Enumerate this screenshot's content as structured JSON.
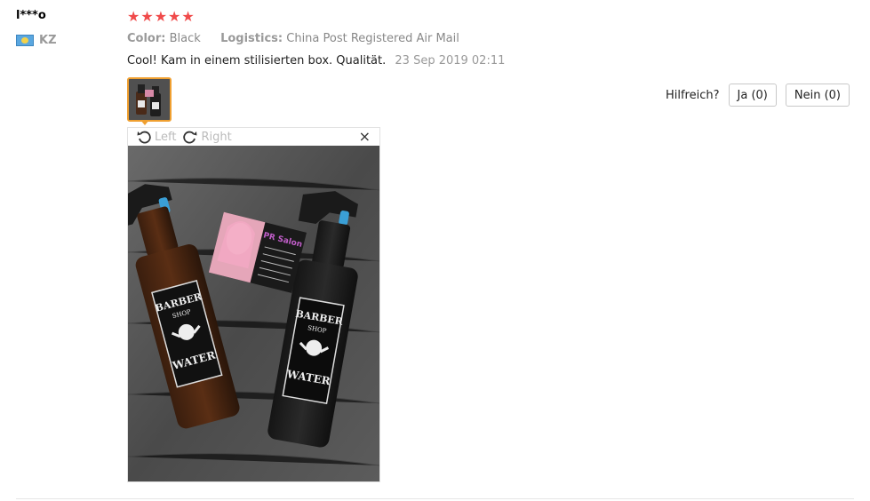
{
  "review": {
    "user_name": "l***o",
    "country_code": "KZ",
    "rating": 5,
    "color_label": "Color:",
    "color_value": "Black",
    "logistics_label": "Logistics:",
    "logistics_value": "China Post Registered Air Mail",
    "text": "Cool! Kam in einem stilisierten box. Qualität.",
    "date": "23 Sep 2019 02:11"
  },
  "helpful": {
    "label": "Hilfreich?",
    "yes_label": "Ja (0)",
    "no_label": "Nein (0)"
  },
  "viewer": {
    "left_label": "Left",
    "right_label": "Right",
    "close_symbol": "×"
  },
  "photo_labels": {
    "barber": "BARBER",
    "shop": "SHOP",
    "water": "WATER",
    "card_title": "PR Salon"
  },
  "colors": {
    "star": "#f04a4a",
    "thumb_border": "#f0a030"
  },
  "icons": [
    "star-icon",
    "flag-icon",
    "rotate-left-icon",
    "rotate-right-icon",
    "close-icon"
  ]
}
